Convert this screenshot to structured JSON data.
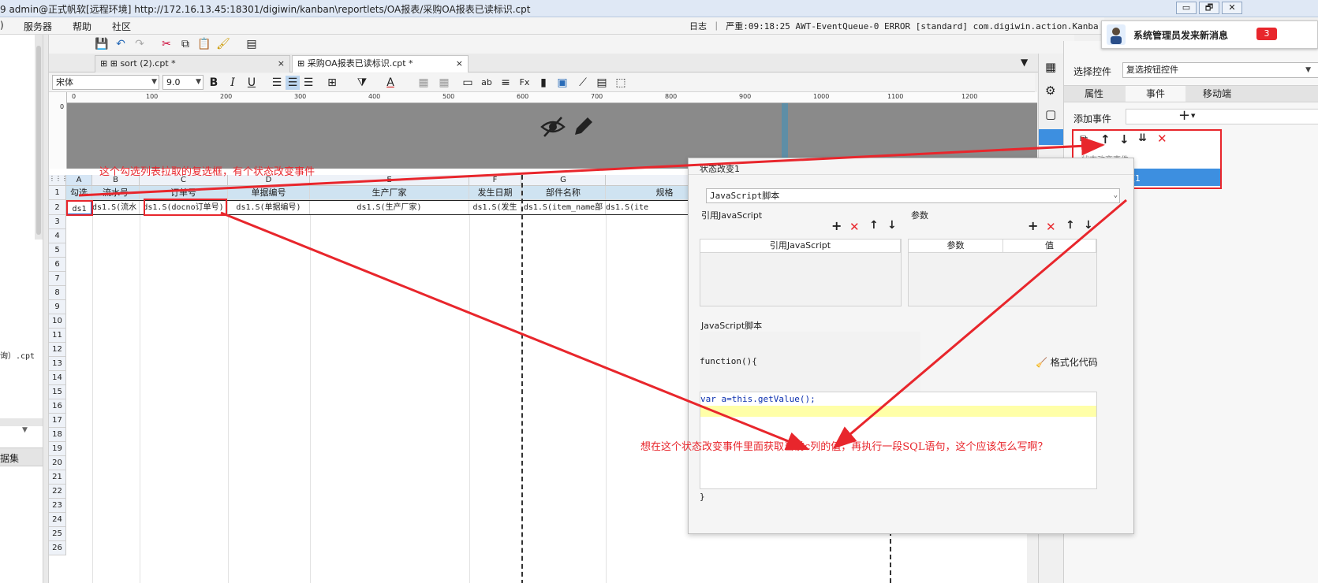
{
  "window": {
    "title": "9 admin@正式帆软[远程环境]    http://172.16.13.45:18301/digiwin/kanban\\reportlets/OA报表/采购OA报表已读标识.cpt",
    "log_text": "日志 ｜ 严重:09:18:25 AWT-EventQueue-0 ERROR [standard] com.digiwin.action.Kanba",
    "btn_min": "▭",
    "btn_max": "🗗",
    "btn_close": "✕"
  },
  "menu": {
    "item0": ")",
    "item1": "服务器",
    "item2": "帮助",
    "item3": "社区"
  },
  "left_panel": {
    "file_label": "询）.cpt",
    "dataset_label": "据集"
  },
  "tabs": [
    {
      "label": "sort (2).cpt *",
      "close": "×"
    },
    {
      "label": "采购OA报表已读标识.cpt *",
      "close": "×"
    }
  ],
  "format_bar": {
    "font": "宋体",
    "size": "9.0"
  },
  "ruler": [
    "0",
    "100",
    "200",
    "300",
    "400",
    "500",
    "600",
    "700",
    "800",
    "900",
    "1000",
    "1100",
    "1200"
  ],
  "columns": [
    "A",
    "B",
    "C",
    "D",
    "E",
    "F",
    "G"
  ],
  "header_row": [
    "勾选",
    "流水号",
    "订单号",
    "单据编号",
    "生产厂家",
    "发生日期",
    "部件名称",
    "规格"
  ],
  "data_row": [
    "ds1",
    "ds1.S(流水",
    "ds1.S(docno订单号)",
    "ds1.S(单据编号)",
    "ds1.S(生产厂家)",
    "ds1.S(发生",
    "ds1.S(item_name部",
    "ds1.S(ite"
  ],
  "row_numbers": [
    "1",
    "2",
    "3",
    "4",
    "5",
    "6",
    "7",
    "8",
    "9",
    "10",
    "11",
    "12",
    "13",
    "14",
    "15",
    "16",
    "17",
    "18",
    "19",
    "20",
    "21",
    "22",
    "23",
    "24",
    "25",
    "26"
  ],
  "notification": {
    "text": "系统管理员发来新消息",
    "count": "3"
  },
  "right_panel": {
    "select_widget_label": "选择控件",
    "select_widget_value": "复选按钮控件",
    "tabs": [
      "属性",
      "事件",
      "移动端"
    ],
    "add_event_label": "添加事件",
    "event_group": "状态改变事件",
    "event_item": "状态改变1"
  },
  "dialog": {
    "title": "状态改变1",
    "type_select": "JavaScript脚本",
    "ref_js_label": "引用JavaScript",
    "params_label": "参数",
    "ref_js_col": "引用JavaScript",
    "param_col": "参数",
    "value_col": "值",
    "js_section_label": "JavaScript脚本",
    "function_open": "function(){",
    "format_code": "格式化代码",
    "code_line": "var a=this.getValue();",
    "function_close": "}"
  },
  "annotations": {
    "top": "这个勾选列表拉取的复选框，有个状态改变事件",
    "bottom": "想在这个状态改变事件里面获取当前c列的值，再执行一段SQL语句，这个应该怎么写啊？"
  },
  "colors": {
    "annotation": "#e8262c",
    "header_cell": "#cfe3f1",
    "selected_event": "#3d8fe0"
  }
}
